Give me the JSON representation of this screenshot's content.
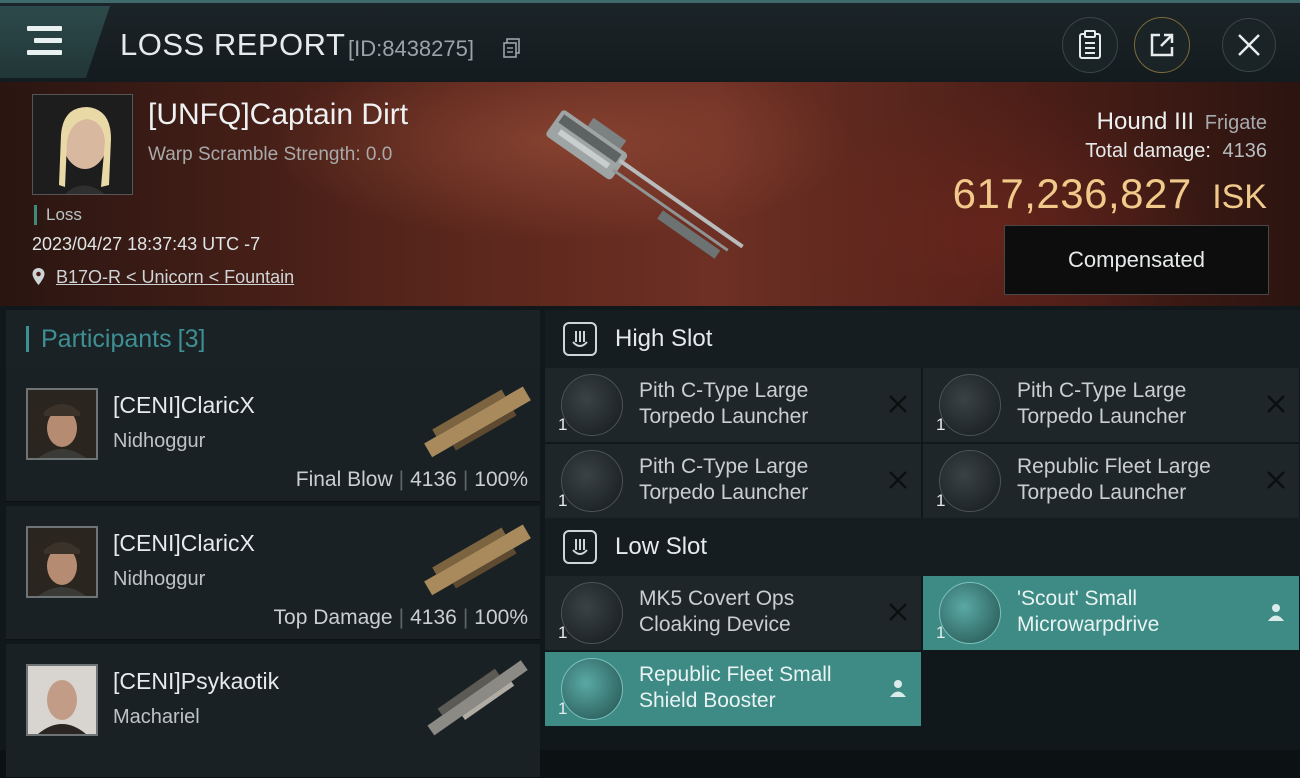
{
  "header": {
    "title": "LOSS REPORT",
    "report_id": "[ID:8438275]",
    "menu_icon": "menu-icon",
    "actions": [
      {
        "name": "clipboard-icon"
      },
      {
        "name": "share-icon"
      },
      {
        "name": "close-icon"
      }
    ]
  },
  "victim": {
    "name": "[UNFQ]Captain Dirt",
    "warp_scramble": "Warp Scramble Strength: 0.0",
    "result": "Loss",
    "timestamp": "2023/04/27 18:37:43 UTC -7",
    "location": "B17O-R < Unicorn < Fountain",
    "ship_name": "Hound III",
    "ship_class": "Frigate",
    "total_damage_label": "Total damage:",
    "total_damage": "4136",
    "isk_value": "617,236,827",
    "isk_unit": "ISK",
    "compensated_label": "Compensated"
  },
  "participants": {
    "label": "Participants",
    "count": "[3]",
    "rows": [
      {
        "name": "[CENI]ClaricX",
        "ship": "Nidhoggur",
        "role": "Final Blow",
        "damage": "4136",
        "percent": "100%"
      },
      {
        "name": "[CENI]ClaricX",
        "ship": "Nidhoggur",
        "role": "Top Damage",
        "damage": "4136",
        "percent": "100%"
      },
      {
        "name": "[CENI]Psykaotik",
        "ship": "Machariel",
        "role": "",
        "damage": "",
        "percent": ""
      }
    ]
  },
  "fitting": {
    "high_slot_label": "High Slot",
    "low_slot_label": "Low Slot",
    "high": [
      {
        "name": "Pith C-Type Large Torpedo Launcher",
        "qty": "1",
        "state": "destroyed"
      },
      {
        "name": "Pith C-Type Large Torpedo Launcher",
        "qty": "1",
        "state": "destroyed"
      },
      {
        "name": "Pith C-Type Large Torpedo Launcher",
        "qty": "1",
        "state": "destroyed"
      },
      {
        "name": "Republic Fleet Large Torpedo Launcher",
        "qty": "1",
        "state": "destroyed"
      }
    ],
    "low": [
      {
        "name": "MK5 Covert Ops Cloaking Device",
        "qty": "1",
        "state": "destroyed"
      },
      {
        "name": "'Scout' Small Microwarpdrive",
        "qty": "1",
        "state": "dropped"
      },
      {
        "name": "Republic Fleet Small Shield Booster",
        "qty": "1",
        "state": "dropped"
      }
    ]
  },
  "colors": {
    "accent_teal": "#3e8b86",
    "isk_gold": "#f1c98a",
    "participants_teal": "#3e8f93"
  }
}
